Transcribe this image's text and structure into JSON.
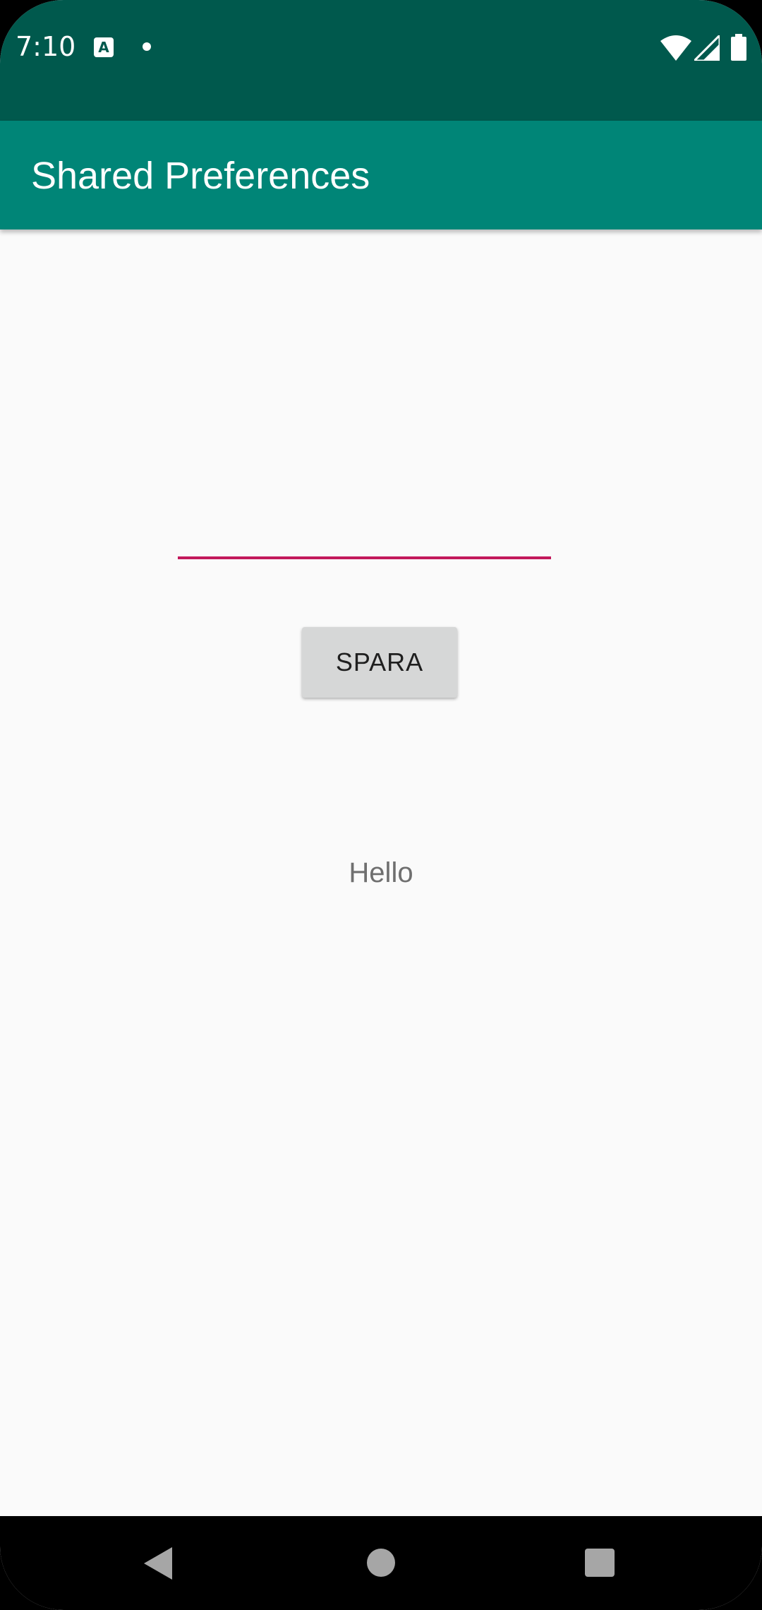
{
  "status_bar": {
    "time": "7:10",
    "notification_icon_letter": "A",
    "icons": [
      "a-notification-icon",
      "dot-icon",
      "wifi-icon",
      "signal-icon",
      "battery-icon"
    ],
    "background_color": "#00594d"
  },
  "app_bar": {
    "title": "Shared Preferences",
    "background_color": "#008577"
  },
  "form": {
    "input_value": "",
    "input_placeholder": "",
    "underline_color": "#c2185b",
    "save_label": "SPARA"
  },
  "output": {
    "text": "Hello"
  },
  "nav_bar": {
    "icons": [
      "back-icon",
      "home-icon",
      "recents-icon"
    ]
  }
}
